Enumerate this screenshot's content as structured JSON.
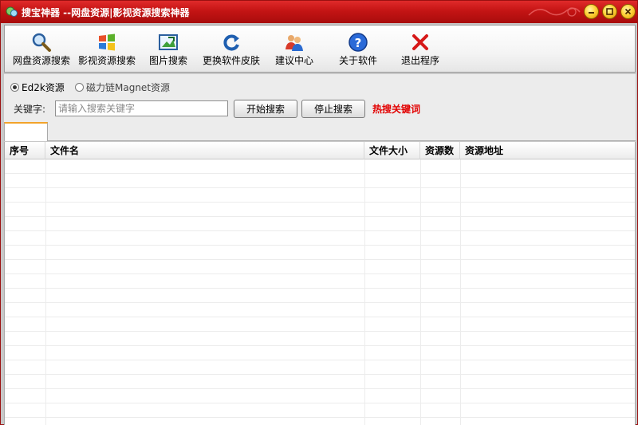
{
  "window": {
    "title": "搜宝神器 --网盘资源|影视资源搜索神器",
    "colors": {
      "titlebar": "#c41414",
      "hot_text": "#e20000",
      "tab_accent": "#f2a32a"
    }
  },
  "toolbar": {
    "items": [
      {
        "label": "网盘资源搜索",
        "icon": "magnifier-icon"
      },
      {
        "label": "影视资源搜索",
        "icon": "windows-logo-icon"
      },
      {
        "label": "图片搜索",
        "icon": "picture-icon"
      },
      {
        "label": "更换软件皮肤",
        "icon": "refresh-icon"
      },
      {
        "label": "建议中心",
        "icon": "users-icon"
      },
      {
        "label": "关于软件",
        "icon": "help-icon"
      },
      {
        "label": "退出程序",
        "icon": "exit-x-icon"
      }
    ]
  },
  "search": {
    "radio_ed2k": "Ed2k资源",
    "radio_magnet": "磁力链Magnet资源",
    "selected": "Ed2k资源",
    "keyword_label": "关键字:",
    "placeholder": "请输入搜索关键字",
    "value": "",
    "start_button": "开始搜索",
    "stop_button": "停止搜索",
    "hot_keywords": "热搜关键词"
  },
  "table": {
    "columns": [
      "序号",
      "文件名",
      "文件大小",
      "资源数",
      "资源地址"
    ],
    "rows": []
  }
}
